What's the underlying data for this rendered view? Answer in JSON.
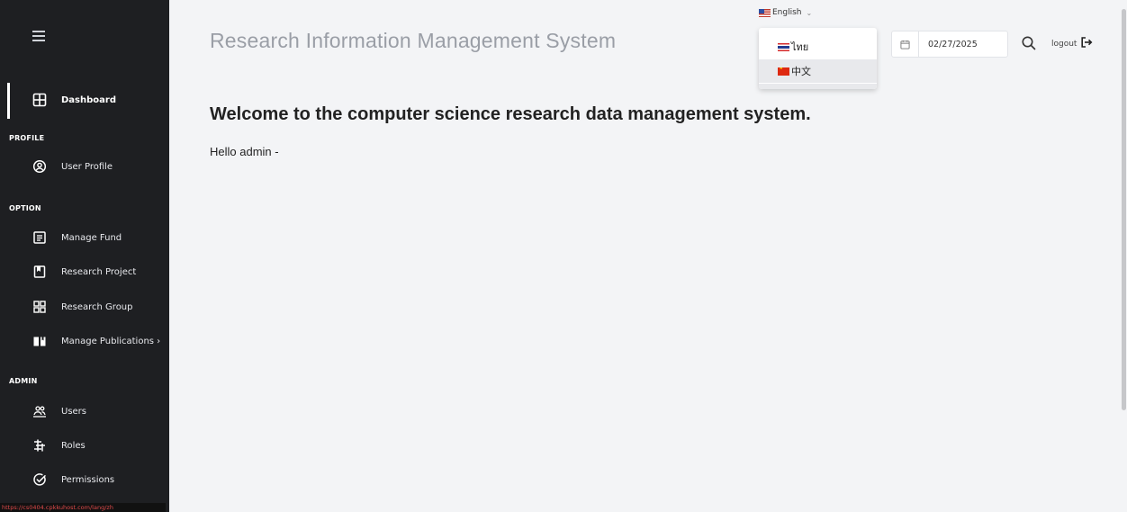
{
  "sidebar": {
    "dashboard_label": "Dashboard",
    "sections": {
      "profile": "PROFILE",
      "option": "OPTION",
      "admin": "ADMIN"
    },
    "items": {
      "user_profile": "User Profile",
      "manage_fund": "Manage Fund",
      "research_project": "Research Project",
      "research_group": "Research Group",
      "manage_publications": "Manage Publications ›",
      "users": "Users",
      "roles": "Roles",
      "permissions": "Permissions"
    },
    "status_url": "https://cs0404.cpkkuhost.com/lang/zh"
  },
  "header": {
    "title": "Research Information Management System",
    "language": {
      "current": "English",
      "options": [
        "ไทย",
        "中文"
      ]
    },
    "date_value": "02/27/2025",
    "logout_label": "logout"
  },
  "main": {
    "welcome": "Welcome to the computer science research data management system.",
    "hello": "Hello admin -"
  },
  "colors": {
    "sidebar_bg": "#1e1f22",
    "page_bg": "#f3f4f6"
  },
  "icons": [
    "menu-icon",
    "dashboard-icon",
    "user-circle-icon",
    "document-icon",
    "bookmark-icon",
    "grid-icon",
    "book-open-icon",
    "users-icon",
    "roles-icon",
    "check-circle-icon",
    "calendar-icon",
    "search-icon",
    "logout-icon",
    "chevron-down-icon"
  ]
}
